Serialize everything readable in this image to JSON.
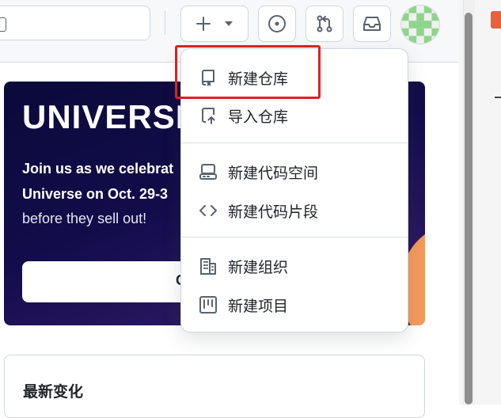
{
  "header": {
    "icons": {
      "create": "plus-icon",
      "create_caret": "triangle-down-icon",
      "issues": "issue-opened-icon",
      "pulls": "git-pull-request-icon",
      "inbox": "inbox-icon"
    }
  },
  "banner": {
    "title": "UNIVERSE",
    "line1": "Join us as we celebrat",
    "line2": "Universe on Oct. 29-3",
    "line3": "before they sell out!",
    "cta_label": "G"
  },
  "changes_card": {
    "title": "最新变化"
  },
  "create_menu": {
    "items": [
      {
        "label": "新建仓库",
        "icon": "repo-icon"
      },
      {
        "label": "导入仓库",
        "icon": "repo-push-icon"
      },
      {
        "label": "新建代码空间",
        "icon": "codespaces-icon"
      },
      {
        "label": "新建代码片段",
        "icon": "code-icon"
      },
      {
        "label": "新建组织",
        "icon": "organization-icon"
      },
      {
        "label": "新建项目",
        "icon": "project-icon"
      }
    ]
  },
  "colors": {
    "highlight": "#e02020",
    "banner_bg": "#0b0a3a",
    "accent_orb": "#f59a5c",
    "border": "#d0d7de"
  }
}
